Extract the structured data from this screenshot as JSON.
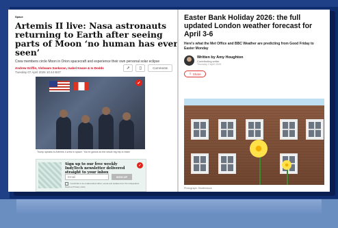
{
  "left_article": {
    "section": "Space",
    "headline": "Artemis II live: Nasa astronauts returning to Earth after seeing parts of Moon ‘no human has ever seen’",
    "standfirst": "Crew members circle Moon in Orion spacecraft and experience their own personal solar eclipse",
    "byline": "Andrew Griffin, Vishwam Sankaran, Isabel Keane & Io Dodds",
    "date": "Tuesday 07 April 2026 10:44 BST",
    "comments_label": "Comments",
    "bookmark_icon": "bookmark-icon",
    "share_icon": "share-icon",
    "caption": "Trump speaks to Artemis II crew in space: ‘You’re gonna do the whole big trip to Mars’",
    "newsletter": {
      "title": "Sign up to our free weekly IndyTech newsletter delivered straight to your inbox",
      "email_placeholder": "Email",
      "signup_label": "SIGN UP",
      "terms": "I would like to be emailed about offers, events and updates from The Independent. Read our Privacy notice"
    }
  },
  "right_article": {
    "headline": "Easter Bank Holiday 2026: the full updated London weather forecast for April 3-6",
    "subhead": "Here's what the Met Office and BBC Weather are predicting from Good Friday to Easter Monday",
    "author": {
      "name": "Written by Amy Houghton",
      "role": "Contributing writer",
      "date": "Thursday 2 April 2026"
    },
    "share_label": "Share",
    "photo_credit": "Photograph: Shutterstock"
  },
  "colors": {
    "accent_red": "#d0021b",
    "frame_blue": "#1f3f86"
  }
}
